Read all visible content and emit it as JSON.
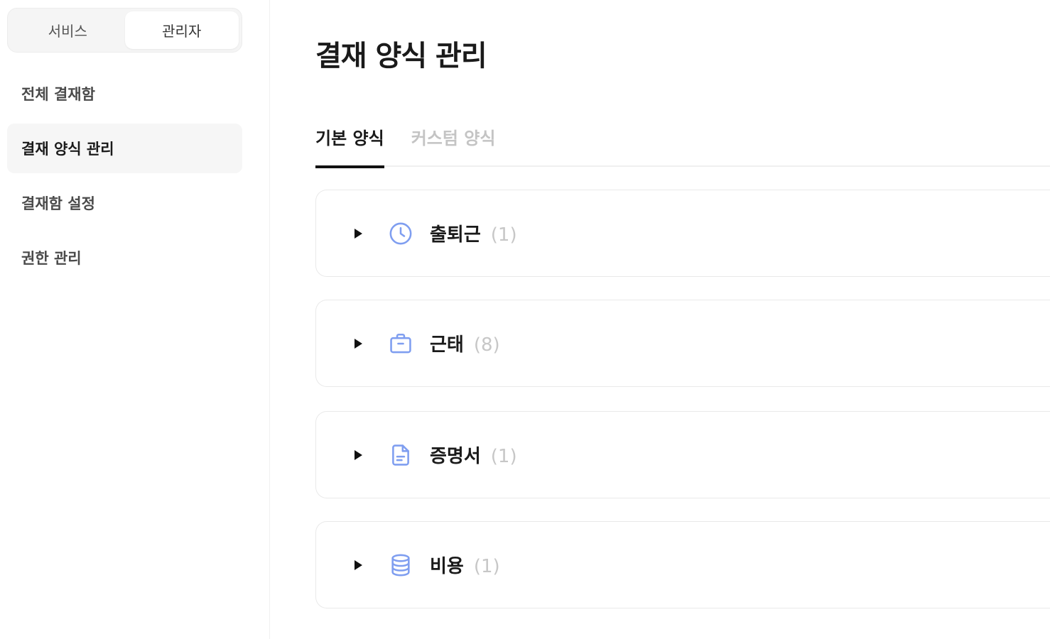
{
  "sidebar": {
    "mode_toggle": {
      "service_label": "서비스",
      "admin_label": "관리자",
      "selected": "관리자"
    },
    "nav_items": [
      {
        "label": "전체 결재함",
        "active": false
      },
      {
        "label": "결재 양식 관리",
        "active": true
      },
      {
        "label": "결재함 설정",
        "active": false
      },
      {
        "label": "권한 관리",
        "active": false
      }
    ]
  },
  "main": {
    "title": "결재 양식 관리",
    "tabs": [
      {
        "label": "기본 양식",
        "active": true
      },
      {
        "label": "커스텀 양식",
        "active": false
      }
    ],
    "groups": [
      {
        "name": "출퇴근",
        "count": "(1)",
        "icon": "clock-icon"
      },
      {
        "name": "근태",
        "count": "(8)",
        "icon": "briefcase-icon"
      },
      {
        "name": "증명서",
        "count": "(1)",
        "icon": "document-icon"
      },
      {
        "name": "비용",
        "count": "(1)",
        "icon": "database-icon"
      }
    ]
  },
  "colors": {
    "icon_accent": "#7f9ef0",
    "active_tab_underline": "#111111",
    "count_gray": "#c7c7c7"
  }
}
